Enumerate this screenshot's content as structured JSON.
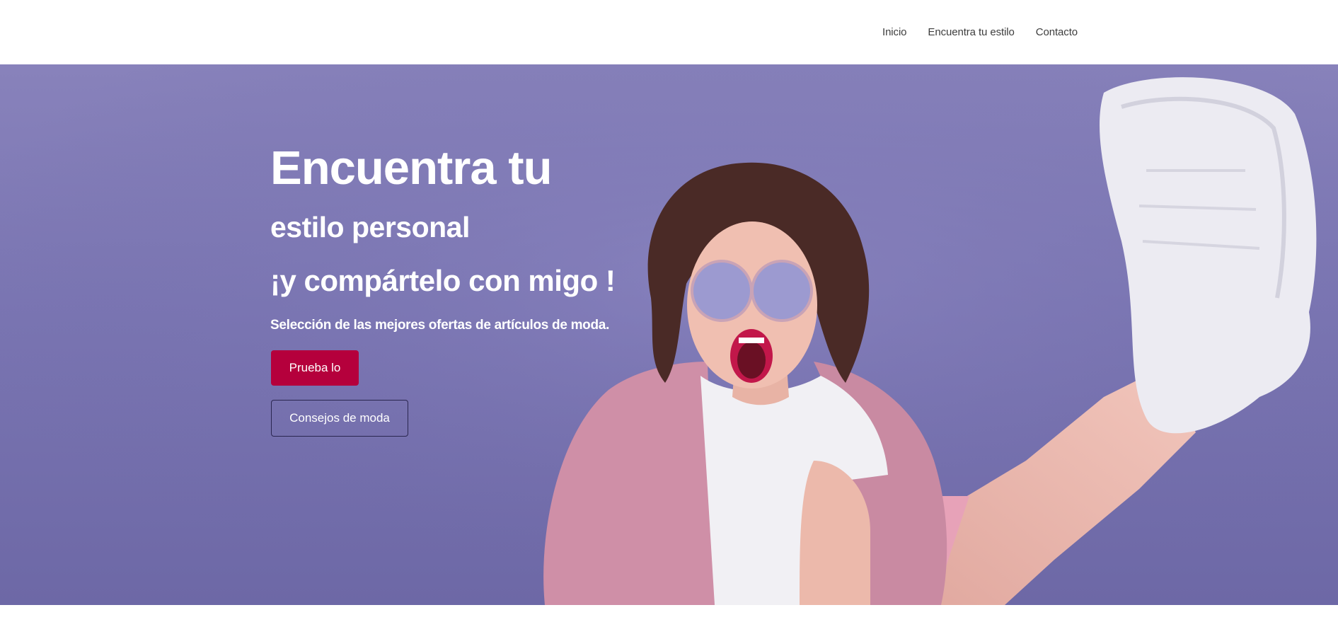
{
  "nav": {
    "items": [
      {
        "label": "Inicio"
      },
      {
        "label": "Encuentra tu estilo"
      },
      {
        "label": "Contacto"
      }
    ]
  },
  "hero": {
    "headline_line1": "Encuentra tu",
    "headline_line2": "estilo personal",
    "headline_line3": "¡y compártelo con migo !",
    "subline": "Selección de las mejores ofertas de artículos de moda.",
    "primary_button": "Prueba lo",
    "secondary_button": "Consejos de moda"
  },
  "colors": {
    "hero_background": "#7a75b2",
    "primary_button": "#b5003c",
    "outline_border": "#2a2650",
    "nav_text": "#3d3d3d"
  }
}
